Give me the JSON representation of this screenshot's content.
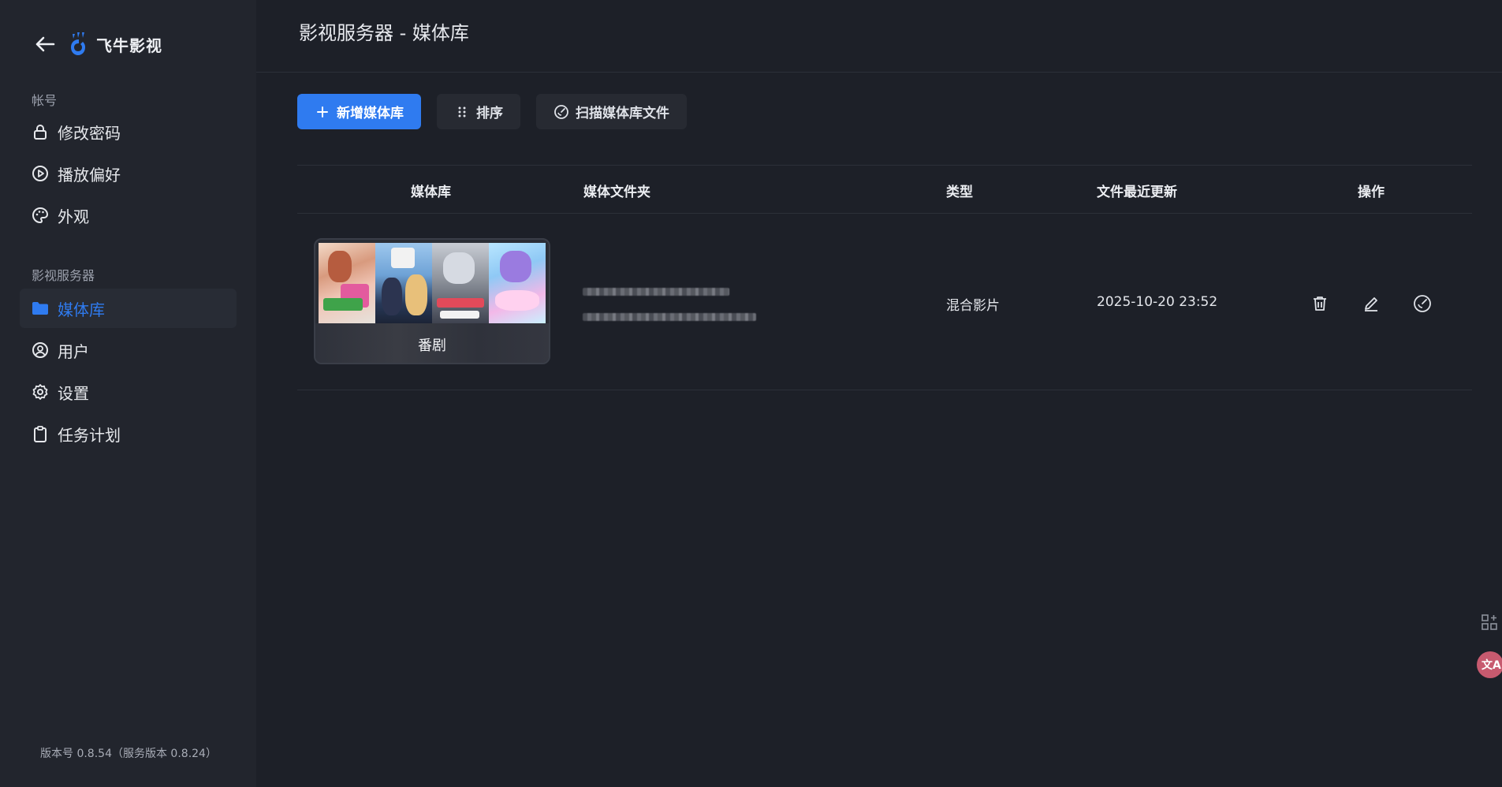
{
  "app": {
    "name": "飞牛影视"
  },
  "sidebar": {
    "section_account": "帐号",
    "section_server": "影视服务器",
    "items": [
      {
        "label": "修改密码",
        "icon": "lock-icon"
      },
      {
        "label": "播放偏好",
        "icon": "play-circle-icon"
      },
      {
        "label": "外观",
        "icon": "palette-icon"
      },
      {
        "label": "媒体库",
        "icon": "folder-icon",
        "active": true
      },
      {
        "label": "用户",
        "icon": "user-circle-icon"
      },
      {
        "label": "设置",
        "icon": "gear-icon"
      },
      {
        "label": "任务计划",
        "icon": "clipboard-icon"
      }
    ],
    "version": "版本号 0.8.54（服务版本 0.8.24）"
  },
  "header": {
    "title": "影视服务器 - 媒体库"
  },
  "toolbar": {
    "add_label": "新增媒体库",
    "sort_label": "排序",
    "scan_label": "扫描媒体库文件"
  },
  "table": {
    "columns": [
      "媒体库",
      "媒体文件夹",
      "类型",
      "文件最近更新",
      "操作"
    ],
    "rows": [
      {
        "library": "番剧",
        "type": "混合影片",
        "updated": "2025-10-20 23:52"
      }
    ]
  },
  "colors": {
    "accent": "#2f7bf0",
    "background": "#1d2028",
    "sidebar": "#22252d"
  }
}
